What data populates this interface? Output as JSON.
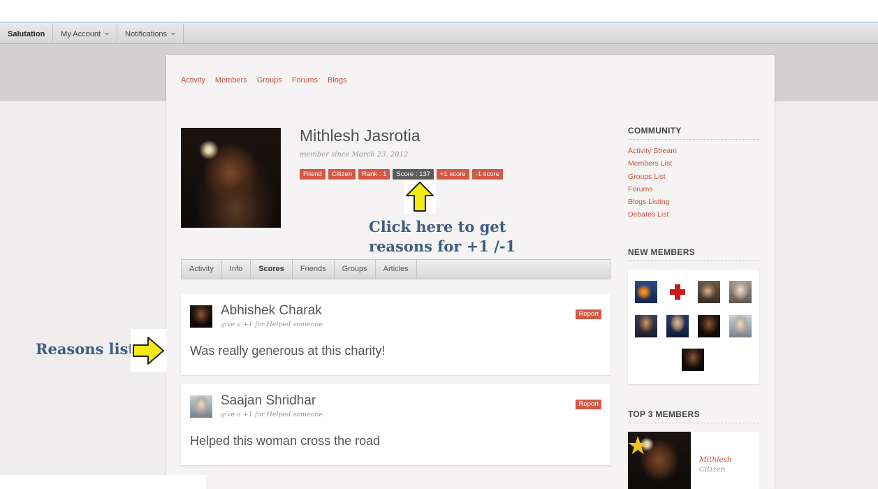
{
  "adminbar": {
    "brand": "Salutation",
    "my_account": "My Account",
    "notifications": "Notifications"
  },
  "topnav": [
    "Activity",
    "Members",
    "Groups",
    "Forums",
    "Blogs"
  ],
  "profile": {
    "name": "Mithlesh Jasrotia",
    "member_since": "member since March 23, 2012",
    "badges": {
      "friend": "Friend",
      "citizen": "Citizen",
      "rank": "Rank : 1",
      "score": "Score : 137",
      "plus": "+1 score",
      "minus": "-1 score"
    }
  },
  "annotations": {
    "click_here": "Click here to get\nreasons for +1 /-1",
    "reasons_list": "Reasons list"
  },
  "tabs": [
    "Activity",
    "Info",
    "Scores",
    "Friends",
    "Groups",
    "Articles"
  ],
  "active_tab": "Scores",
  "scores": [
    {
      "author": "Abhishek Charak",
      "reason": "give a +1 for Helped someone",
      "report": "Report",
      "text": "Was really generous at this charity!"
    },
    {
      "author": "Saajan Shridhar",
      "reason": "give a +1 for Helped someone",
      "report": "Report",
      "text": "Helped this woman cross the road"
    }
  ],
  "sidebar": {
    "community_title": "COMMUNITY",
    "community_links": [
      "Activity Stream",
      "Members List",
      "Groups List",
      "Forums",
      "Blogs Listing",
      "Debates List"
    ],
    "new_members_title": "NEW MEMBERS",
    "top_members_title": "TOP 3 MEMBERS",
    "top_member": {
      "name": "Mithlesh",
      "subtitle": "Citizen"
    }
  },
  "colors": {
    "accent": "#d45944",
    "link": "#c6523c",
    "annotation": "#3f5c82",
    "arrow": "#f5ea14"
  }
}
